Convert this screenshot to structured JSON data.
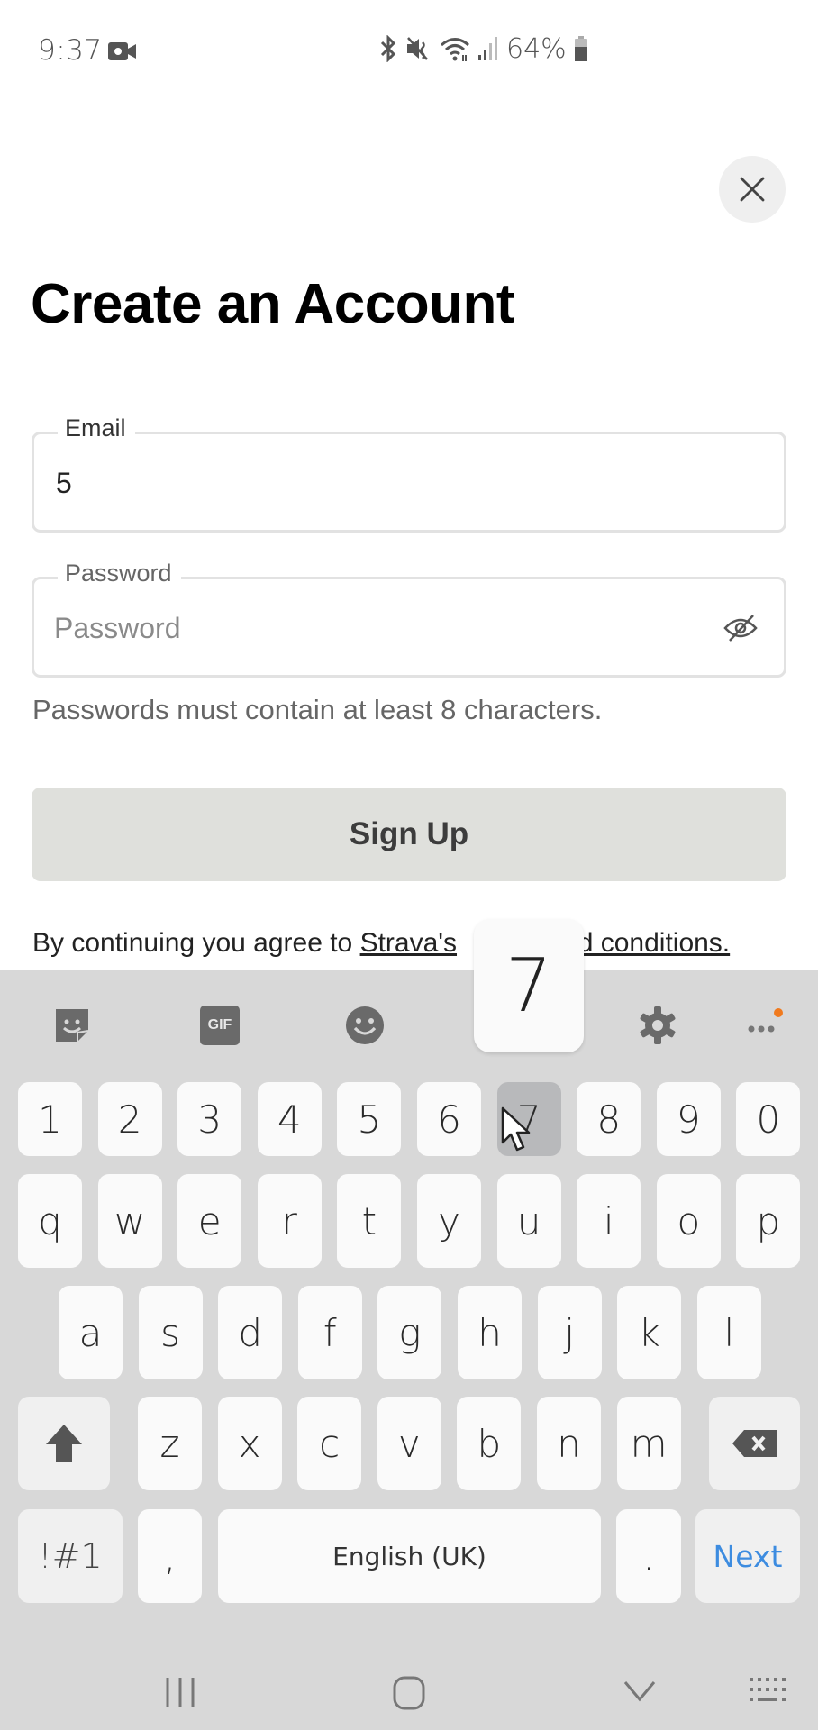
{
  "status_bar": {
    "time": "9:37",
    "battery_percent": "64%",
    "icons": [
      "video-record-icon",
      "bluetooth-icon",
      "mute-icon",
      "wifi-icon",
      "signal-icon",
      "battery-icon"
    ]
  },
  "header": {
    "close_icon": "close-icon",
    "title": "Create an Account"
  },
  "form": {
    "email": {
      "label": "Email",
      "value": "5"
    },
    "password": {
      "label": "Password",
      "value": "",
      "placeholder": "Password",
      "toggle_icon": "eye-off-icon"
    },
    "hint": "Passwords must contain at least 8 characters.",
    "submit_label": "Sign Up",
    "submit_bg": "#dfe0dc",
    "terms_prefix": "By continuing you agree to ",
    "terms_link_visible_start": "Strava's",
    "terms_link_visible_end": "nd conditions."
  },
  "keyboard": {
    "toolbar": [
      "sticker-icon",
      "gif-icon",
      "emoji-icon",
      "settings-icon",
      "more-icon"
    ],
    "gif_label": "GIF",
    "popup_key": "7",
    "row_numbers": [
      "1",
      "2",
      "3",
      "4",
      "5",
      "6",
      "7",
      "8",
      "9",
      "0"
    ],
    "pressed_key": "7",
    "row1": [
      "q",
      "w",
      "e",
      "r",
      "t",
      "y",
      "u",
      "i",
      "o",
      "p"
    ],
    "row2": [
      "a",
      "s",
      "d",
      "f",
      "g",
      "h",
      "j",
      "k",
      "l"
    ],
    "row3": [
      "z",
      "x",
      "c",
      "v",
      "b",
      "n",
      "m"
    ],
    "symbols_label": "!#1",
    "comma": ",",
    "space_label": "English (UK)",
    "period": ".",
    "action_label": "Next",
    "action_color": "#3d8ce0",
    "notification_dot_color": "#f07a1e"
  },
  "nav_bar": [
    "recents-icon",
    "home-icon",
    "back-icon",
    "keyboard-switch-icon"
  ]
}
